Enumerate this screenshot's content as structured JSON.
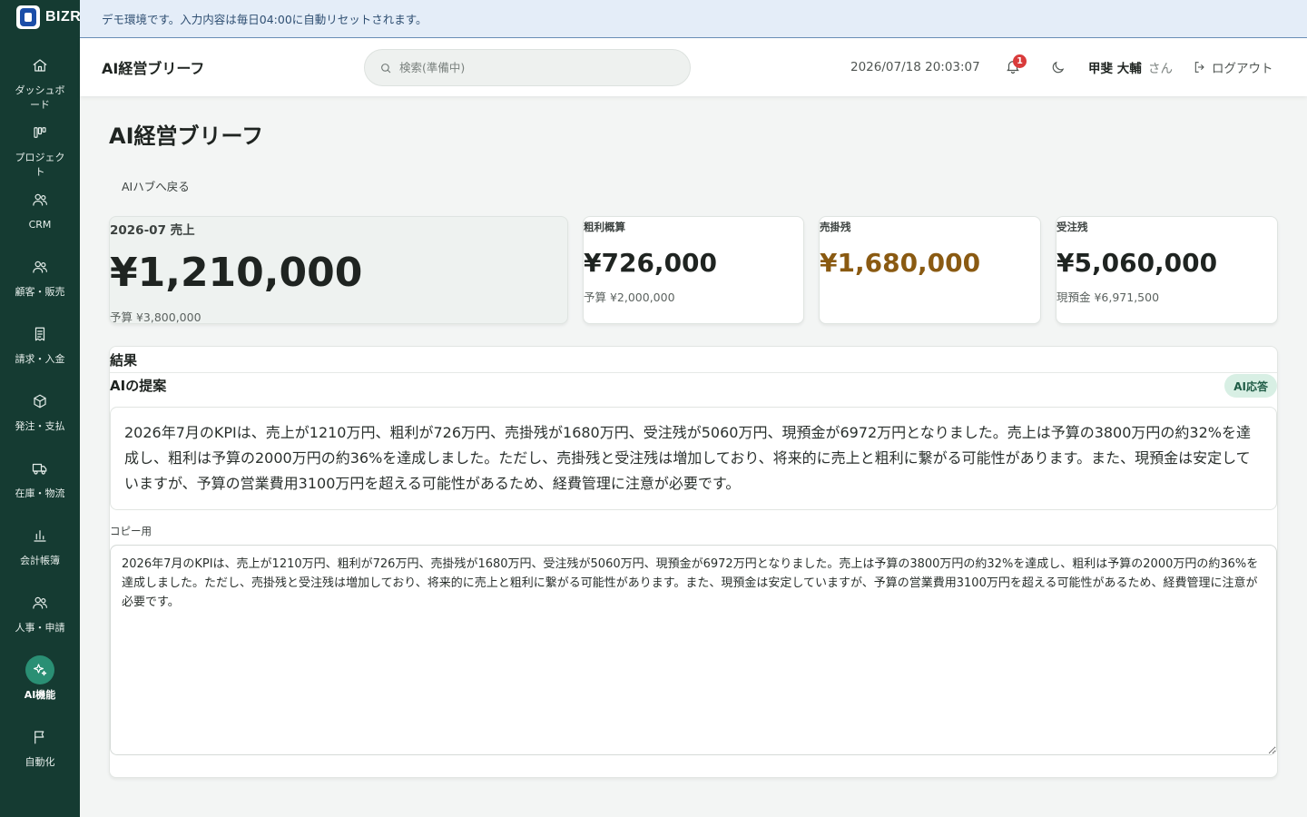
{
  "app": {
    "logo_text": "BIZR"
  },
  "banner": {
    "text": "デモ環境です。入力内容は毎日04:00に自動リセットされます。"
  },
  "sidebar": {
    "items": [
      {
        "label": "ダッシュボード",
        "icon": "home-icon"
      },
      {
        "label": "プロジェクト",
        "icon": "kanban-icon"
      },
      {
        "label": "CRM",
        "icon": "users-icon"
      },
      {
        "label": "顧客・販売",
        "icon": "users-icon"
      },
      {
        "label": "請求・入金",
        "icon": "receipt-icon"
      },
      {
        "label": "発注・支払",
        "icon": "box-icon"
      },
      {
        "label": "在庫・物流",
        "icon": "truck-icon"
      },
      {
        "label": "会計帳簿",
        "icon": "bar-chart-icon"
      },
      {
        "label": "人事・申請",
        "icon": "users-icon"
      },
      {
        "label": "AI機能",
        "icon": "sparkles-icon",
        "active": true
      },
      {
        "label": "自動化",
        "icon": "flag-icon"
      }
    ]
  },
  "header": {
    "title": "AI経営ブリーフ",
    "search_placeholder": "検索(準備中)",
    "datetime": "2026/07/18 20:03:07",
    "notification_count": "1",
    "user_name": "甲斐 大輔",
    "user_suffix": "さん",
    "logout_label": "ログアウト"
  },
  "main": {
    "page_title": "AI経営ブリーフ",
    "back_label": "AIハブへ戻る",
    "kpis": {
      "sales": {
        "label": "2026-07 売上",
        "value": "¥1,210,000",
        "sub": "予算 ¥3,800,000"
      },
      "gross": {
        "label": "粗利概算",
        "value": "¥726,000",
        "sub": "予算 ¥2,000,000"
      },
      "receivable": {
        "label": "売掛残",
        "value": "¥1,680,000",
        "sub": ""
      },
      "backlog": {
        "label": "受注残",
        "value": "¥5,060,000",
        "sub": "現預金 ¥6,971,500"
      }
    },
    "result": {
      "heading": "結果",
      "proposal_title": "AIの提案",
      "badge": "AI応答",
      "answer": "2026年7月のKPIは、売上が1210万円、粗利が726万円、売掛残が1680万円、受注残が5060万円、現預金が6972万円となりました。売上は予算の3800万円の約32%を達成し、粗利は予算の2000万円の約36%を達成しました。ただし、売掛残と受注残は増加しており、将来的に売上と粗利に繋がる可能性があります。また、現預金は安定していますが、予算の営業費用3100万円を超える可能性があるため、経費管理に注意が必要です。",
      "copy_label": "コピー用",
      "copy_text": "2026年7月のKPIは、売上が1210万円、粗利が726万円、売掛残が1680万円、受注残が5060万円、現預金が6972万円となりました。売上は予算の3800万円の約32%を達成し、粗利は予算の2000万円の約36%を達成しました。ただし、売掛残と受注残は増加しており、将来的に売上と粗利に繋がる可能性があります。また、現預金は安定していますが、予算の営業費用3100万円を超える可能性があるため、経費管理に注意が必要です。"
    }
  },
  "colors": {
    "sidebar": "#153b32",
    "accent": "#2a8f74",
    "receivable_value": "#8a5a12",
    "badge_bg": "#d8efe4"
  }
}
